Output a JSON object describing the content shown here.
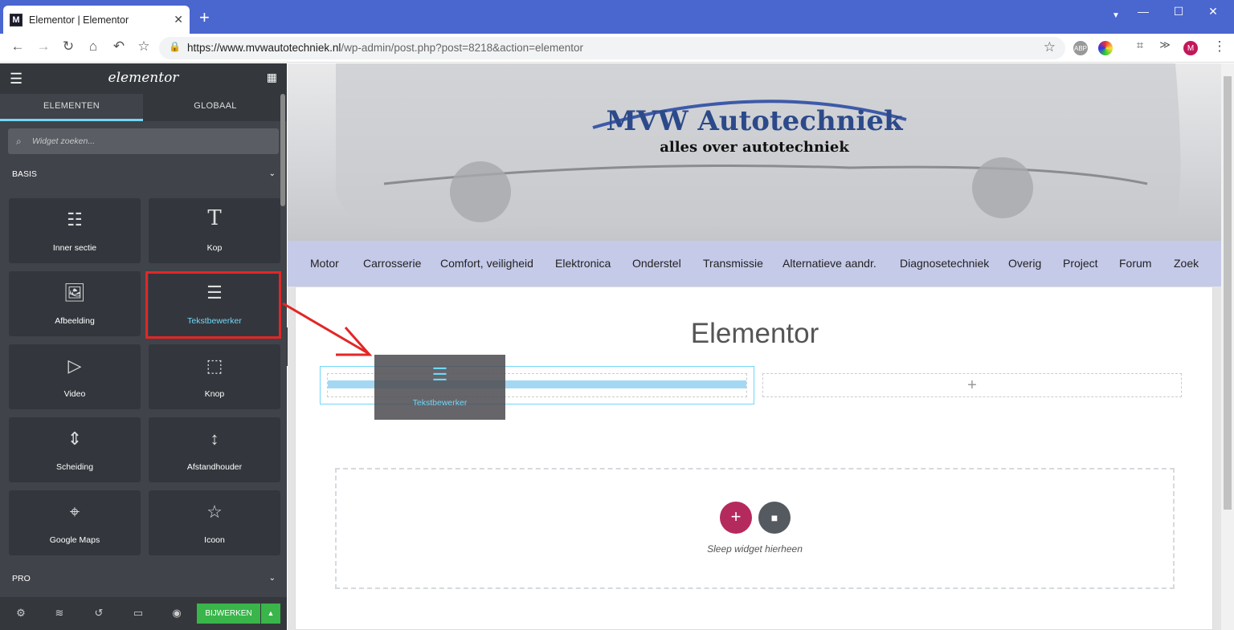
{
  "browser": {
    "tab_title": "Elementor | Elementor",
    "tab_favicon": "M",
    "new_tab": "+",
    "url_host": "https://www.mvwautotechniek.nl",
    "url_path": "/wp-admin/post.php?post=8218&action=elementor",
    "avatar": "M",
    "ext_abp": "ABP"
  },
  "panel": {
    "logo": "elementor",
    "tabs": [
      "ELEMENTEN",
      "GLOBAAL"
    ],
    "search_placeholder": "Widget zoeken...",
    "category_basis": "BASIS",
    "category_pro": "PRO",
    "widgets": [
      {
        "label": "Inner sectie",
        "icon": "inner-section-icon"
      },
      {
        "label": "Kop",
        "icon": "heading-icon"
      },
      {
        "label": "Afbeelding",
        "icon": "image-icon"
      },
      {
        "label": "Tekstbewerker",
        "icon": "text-editor-icon"
      },
      {
        "label": "Video",
        "icon": "video-icon"
      },
      {
        "label": "Knop",
        "icon": "button-icon"
      },
      {
        "label": "Scheiding",
        "icon": "divider-icon"
      },
      {
        "label": "Afstandhouder",
        "icon": "spacer-icon"
      },
      {
        "label": "Google Maps",
        "icon": "map-icon"
      },
      {
        "label": "Icoon",
        "icon": "star-icon"
      }
    ],
    "save_label": "BIJWERKEN"
  },
  "site": {
    "brand_title": "MVW Autotechniek",
    "brand_subtitle": "alles over autotechniek",
    "nav": [
      "Motor",
      "Carrosserie",
      "Comfort, veiligheid",
      "Elektronica",
      "Onderstel",
      "Transmissie",
      "Alternatieve aandr.",
      "Diagnosetechniek",
      "Overig",
      "Project",
      "Forum",
      "Zoek"
    ],
    "page_title": "Elementor",
    "dragging_widget": "Tekstbewerker",
    "drop_text": "Sleep widget hierheen"
  },
  "colors": {
    "titlebar": "#4a66cf",
    "panel_bg": "#404349",
    "accent": "#71d7f7",
    "highlight": "#e32626",
    "save": "#39b54a",
    "add_button": "#b52a5d",
    "nav_bg": "#c5cae9"
  }
}
